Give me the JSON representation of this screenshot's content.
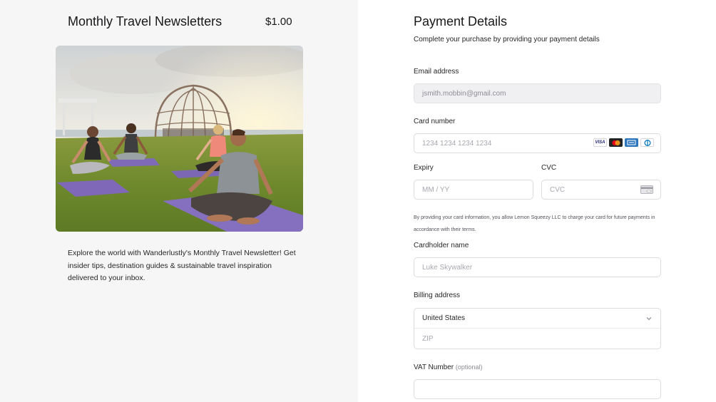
{
  "product": {
    "title": "Monthly Travel Newsletters",
    "price": "$1.00",
    "description": "Explore the world with Wanderlustly's Monthly Travel Newsletter! Get insider tips, destination guides & sustainable travel inspiration delivered to your inbox."
  },
  "payment": {
    "title": "Payment Details",
    "subtitle": "Complete your purchase by providing your payment details",
    "email": {
      "label": "Email address",
      "value": "jsmith.mobbin@gmail.com"
    },
    "card_number": {
      "label": "Card number",
      "placeholder": "1234 1234 1234 1234",
      "brands": [
        "visa-icon",
        "mastercard-icon",
        "amex-icon",
        "diners-icon"
      ],
      "visa_text": "VISA"
    },
    "expiry": {
      "label": "Expiry",
      "placeholder": "MM / YY"
    },
    "cvc": {
      "label": "CVC",
      "placeholder": "CVC",
      "icon": "card-cvc-icon"
    },
    "consent_note": "By providing your card information, you allow Lemon Squeezy LLC to charge your card for future payments in accordance with their terms.",
    "cardholder": {
      "label": "Cardholder name",
      "placeholder": "Luke Skywalker"
    },
    "billing": {
      "label": "Billing address",
      "country": "United States",
      "zip_placeholder": "ZIP"
    },
    "vat": {
      "label": "VAT Number",
      "optional": "(optional)",
      "value": ""
    }
  },
  "colors": {
    "left_bg": "#f6f6f6",
    "right_bg": "#ffffff",
    "border": "#dcdce0",
    "disabled_bg": "#f0f0f2",
    "visa_blue": "#1a1f71",
    "mastercard_red": "#eb001b",
    "mastercard_orange": "#f79e1b",
    "amex_blue": "#2e77bc"
  }
}
